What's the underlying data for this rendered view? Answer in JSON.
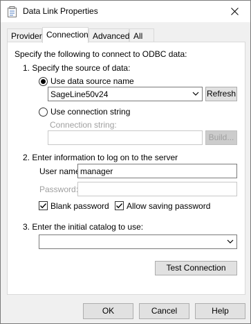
{
  "window": {
    "title": "Data Link Properties",
    "close_icon": "close-icon",
    "app_icon": "data-link-icon"
  },
  "tabs": [
    "Provider",
    "Connection",
    "Advanced",
    "All"
  ],
  "active_tab": "Connection",
  "connection": {
    "intro": "Specify the following to connect to ODBC data:",
    "step1": "1. Specify the source of data:",
    "use_dsn_label": "Use data source name",
    "dsn_value": "SageLine50v24",
    "refresh_label": "Refresh",
    "use_connstr_label": "Use connection string",
    "connstr_label": "Connection string:",
    "connstr_value": "",
    "build_label": "Build...",
    "step2": "2. Enter information to log on to the server",
    "username_label": "User name:",
    "username_value": "manager",
    "password_label": "Password:",
    "password_value": "",
    "blank_password_label": "Blank password",
    "blank_password_checked": true,
    "allow_saving_label": "Allow saving password",
    "allow_saving_checked": true,
    "step3": "3. Enter the initial catalog to use:",
    "catalog_value": "",
    "test_label": "Test Connection"
  },
  "footer": {
    "ok_label": "OK",
    "cancel_label": "Cancel",
    "help_label": "Help"
  }
}
